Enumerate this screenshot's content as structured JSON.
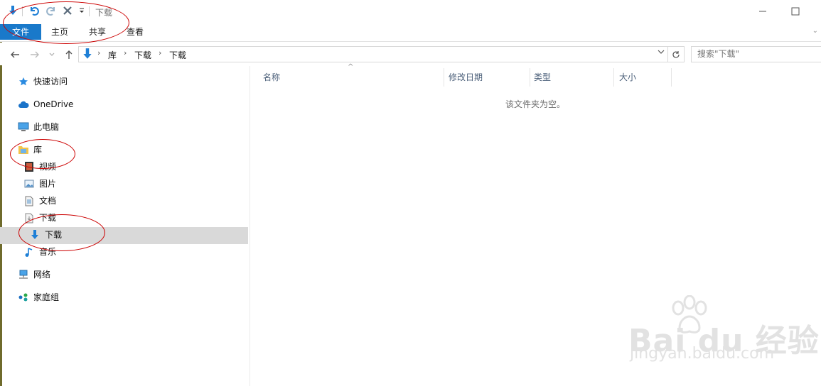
{
  "window": {
    "title": "下载",
    "qat": [
      "download-icon",
      "undo-icon",
      "redo-icon",
      "delete-icon",
      "customize-dropdown-icon"
    ]
  },
  "ribbon": {
    "tabs": [
      {
        "label": "文件",
        "active": true
      },
      {
        "label": "主页"
      },
      {
        "label": "共享"
      },
      {
        "label": "查看"
      }
    ]
  },
  "address": {
    "breadcrumbs": [
      "库",
      "下载",
      "下载"
    ]
  },
  "search": {
    "placeholder": "搜索\"下载\""
  },
  "navpane": {
    "items": [
      {
        "label": "快速访问",
        "icon": "star-icon"
      },
      {
        "label": "OneDrive",
        "icon": "cloud-icon"
      },
      {
        "label": "此电脑",
        "icon": "computer-icon"
      },
      {
        "label": "库",
        "icon": "library-icon"
      },
      {
        "label": "视频",
        "icon": "video-icon"
      },
      {
        "label": "图片",
        "icon": "picture-icon"
      },
      {
        "label": "文档",
        "icon": "document-icon"
      },
      {
        "label": "下载",
        "icon": "download-library-icon"
      },
      {
        "label": "下载",
        "icon": "download-arrow-icon",
        "selected": true
      },
      {
        "label": "音乐",
        "icon": "music-icon"
      },
      {
        "label": "网络",
        "icon": "network-icon"
      },
      {
        "label": "家庭组",
        "icon": "homegroup-icon"
      }
    ]
  },
  "columns": [
    "名称",
    "修改日期",
    "类型",
    "大小"
  ],
  "content": {
    "empty_message": "该文件夹为空。"
  },
  "watermark": {
    "brand": "Bai du 经验",
    "url": "jingyan.baidu.com"
  },
  "colors": {
    "accent": "#1979ca",
    "selection": "#d9d9d9",
    "annotation": "#cc0000"
  }
}
